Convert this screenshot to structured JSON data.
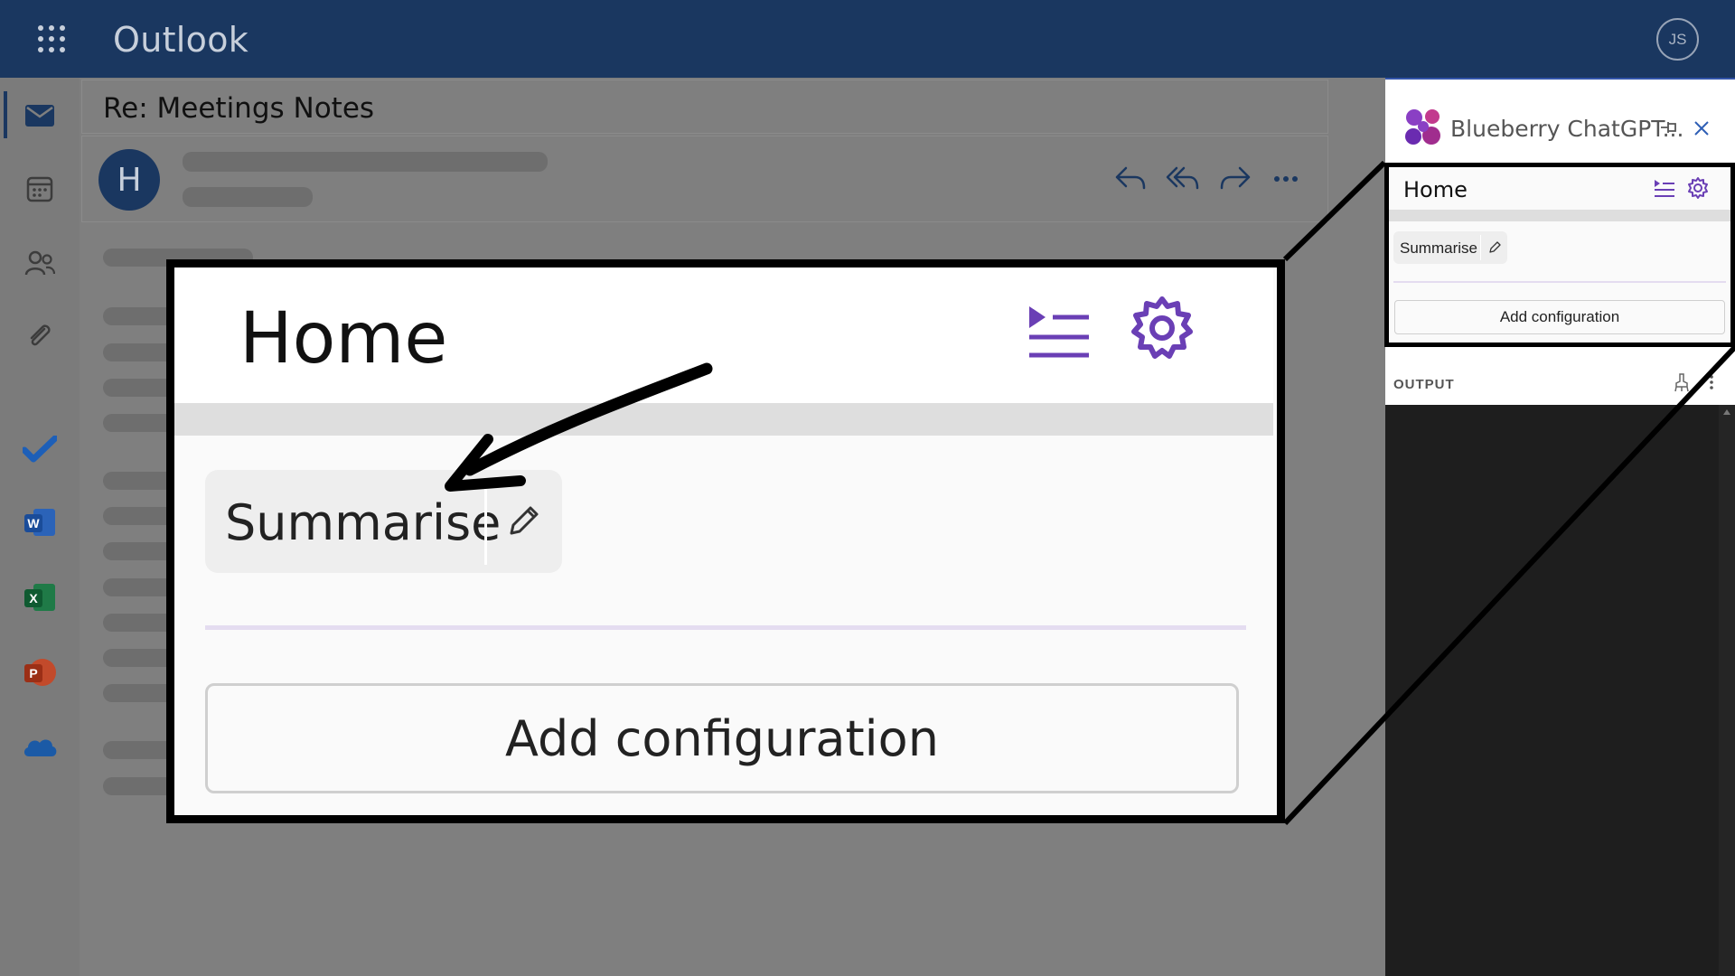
{
  "app": {
    "title": "Outlook",
    "user_initials": "JS"
  },
  "mail": {
    "subject": "Re: Meetings Notes",
    "sender_initial": "H"
  },
  "addin": {
    "title": "Blueberry ChatGPT...",
    "home": {
      "title": "Home",
      "action_label": "Summarise",
      "add_label": "Add configuration"
    },
    "output_label": "OUTPUT"
  },
  "zoom": {
    "home_title": "Home",
    "action_label": "Summarise",
    "add_label": "Add configuration"
  },
  "colors": {
    "topbar": "#1a3760",
    "accent_purple": "#6a3fb5",
    "output_bg": "#1e1e1e"
  }
}
